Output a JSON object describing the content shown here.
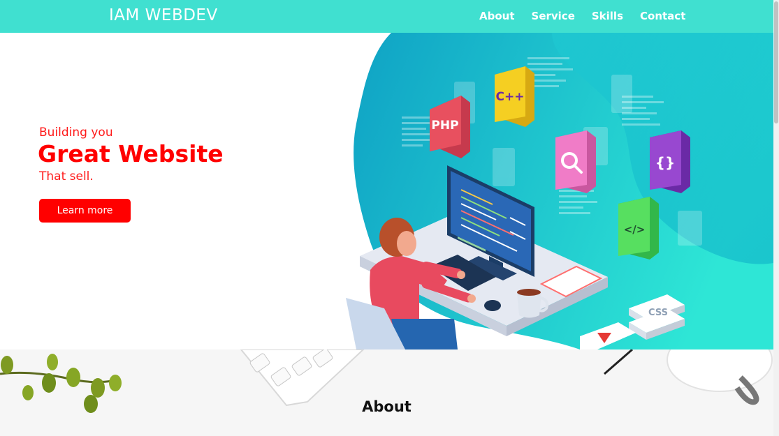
{
  "brand": "IAM WEBDEV",
  "nav": {
    "items": [
      {
        "label": "About"
      },
      {
        "label": "Service"
      },
      {
        "label": "Skills"
      },
      {
        "label": "Contact"
      }
    ]
  },
  "hero": {
    "line1": "Building you",
    "line2": "Great Website",
    "line3": "That sell.",
    "button_label": "Learn more",
    "illustration": {
      "badges": [
        "PHP",
        "C++",
        "{}",
        "</>",
        "CSS"
      ]
    }
  },
  "about": {
    "title": "About"
  },
  "colors": {
    "navbar": "#40e0d0",
    "accent": "#ff0000",
    "blob_start": "#0fa2c5",
    "blob_end": "#2ee6d6"
  }
}
